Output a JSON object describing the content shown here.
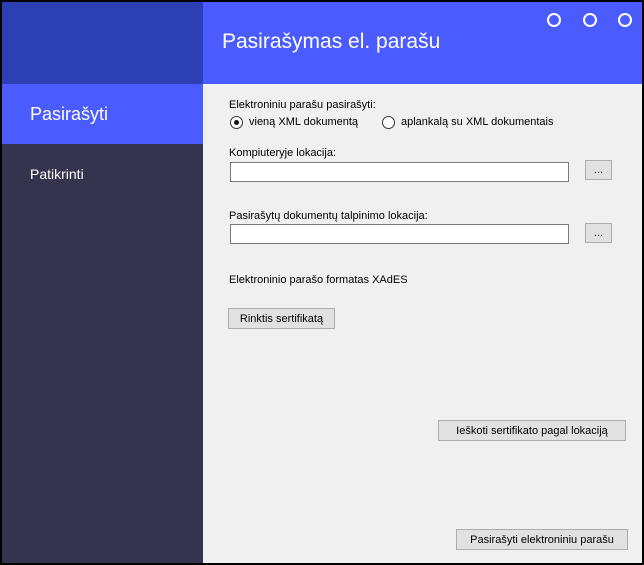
{
  "sidebar": {
    "items": [
      {
        "label": "Pasirašyti"
      },
      {
        "label": "Patikrinti"
      }
    ]
  },
  "header": {
    "title": "Pasirašymas el. parašu"
  },
  "form": {
    "sign_label": "Elektroniniu parašu pasirašyti:",
    "radio_single": "vieną XML dokumentą",
    "radio_folder": "aplankalą su XML dokumentais",
    "location_label": "Kompiuteryje lokacija:",
    "location_value": "",
    "output_label": "Pasirašytų dokumentų talpinimo lokacija:",
    "output_value": "",
    "browse_label": "...",
    "format_text": "Elektroninio parašo formatas XAdES",
    "choose_cert_button": "Rinktis sertifikatą",
    "find_cert_button": "Ieškoti sertifikato pagal lokaciją",
    "sign_button": "Pasirašyti elektroniniu parašu"
  }
}
